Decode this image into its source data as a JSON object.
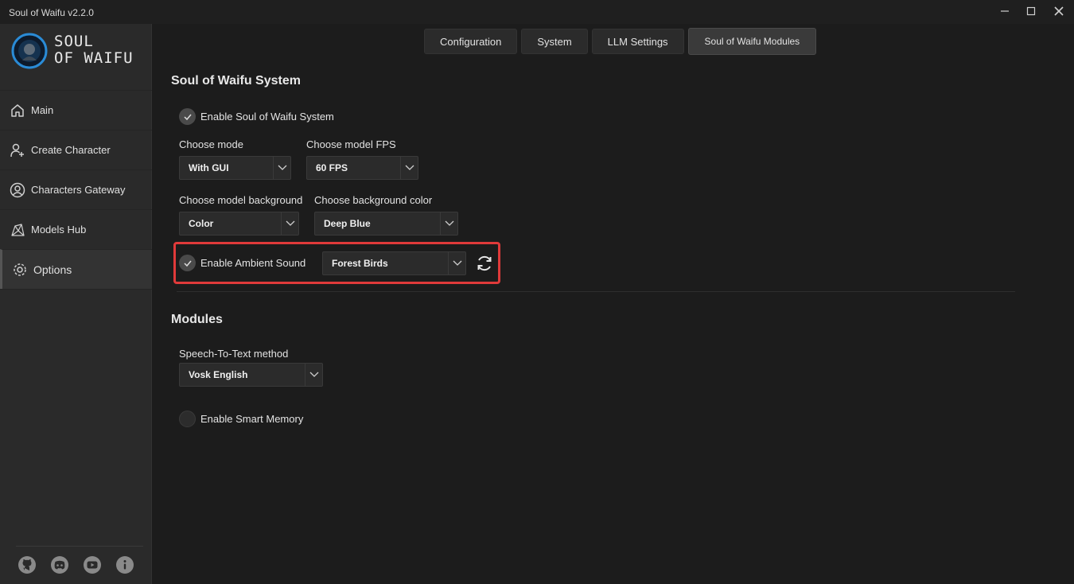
{
  "window": {
    "title": "Soul of Waifu v2.2.0"
  },
  "logo": {
    "line1": "SOUL",
    "line2": "OF WAIFU"
  },
  "sidebar": {
    "items": [
      {
        "label": "Main",
        "icon": "home-icon"
      },
      {
        "label": "Create Character",
        "icon": "add-user-icon"
      },
      {
        "label": "Characters Gateway",
        "icon": "user-circle-icon"
      },
      {
        "label": "Models Hub",
        "icon": "network-icon"
      },
      {
        "label": "Options",
        "icon": "gear-icon",
        "active": true
      }
    ],
    "footer_icons": [
      "github-icon",
      "discord-icon",
      "youtube-icon",
      "info-icon"
    ]
  },
  "tabs": [
    {
      "label": "Configuration"
    },
    {
      "label": "System"
    },
    {
      "label": "LLM Settings"
    },
    {
      "label": "Soul of Waifu Modules",
      "active": true
    }
  ],
  "sow_system": {
    "title": "Soul of Waifu System",
    "enable_label": "Enable Soul of Waifu System",
    "enable_checked": true,
    "mode_label": "Choose mode",
    "mode_value": "With GUI",
    "fps_label": "Choose model FPS",
    "fps_value": "60 FPS",
    "background_label": "Choose model background",
    "background_value": "Color",
    "bgcolor_label": "Choose background color",
    "bgcolor_value": "Deep Blue",
    "ambient_label": "Enable Ambient Sound",
    "ambient_checked": true,
    "ambient_value": "Forest Birds"
  },
  "modules": {
    "title": "Modules",
    "stt_label": "Speech-To-Text method",
    "stt_value": "Vosk English",
    "smart_memory_label": "Enable Smart Memory",
    "smart_memory_checked": false
  },
  "colors": {
    "highlight": "#e03a3a",
    "background": "#1c1c1c",
    "sidebar": "#2a2a2a"
  }
}
